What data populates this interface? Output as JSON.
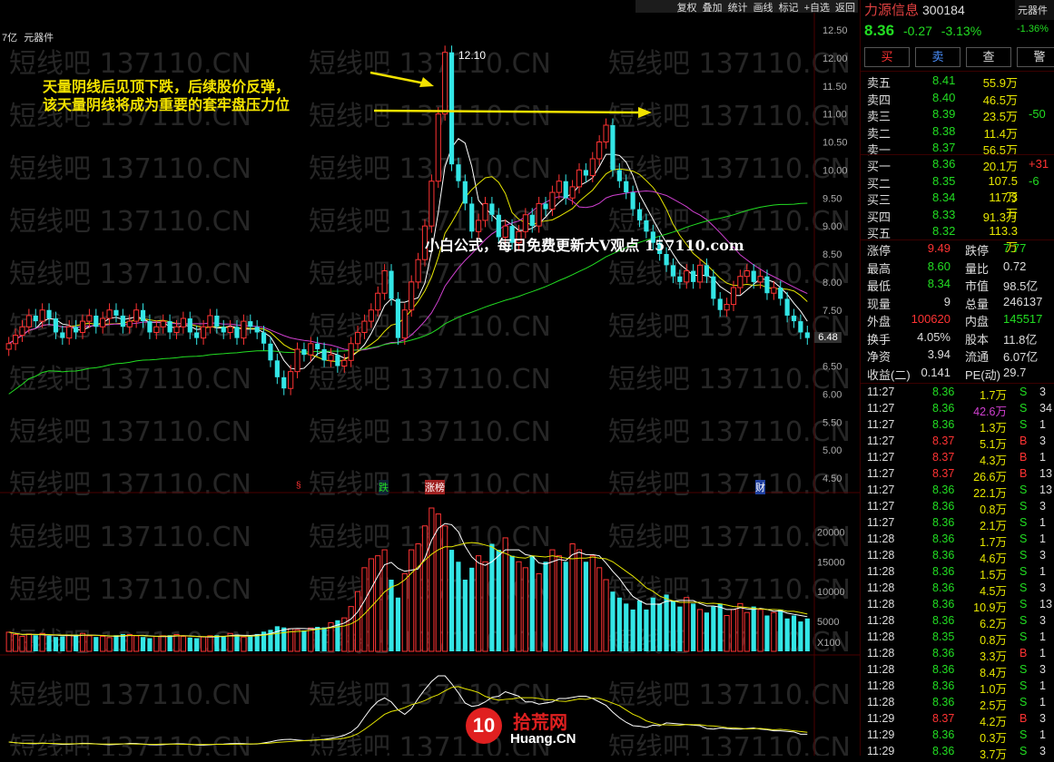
{
  "toolbar": [
    "复权",
    "叠加",
    "统计",
    "画线",
    "标记",
    "+自选",
    "返回"
  ],
  "chart_header": {
    "prefix": "7亿",
    "sector": "元器件"
  },
  "watermark_text": "短线吧 137110.CN",
  "annotation": {
    "line1": "天量阴线后见顶下跌，后续股价反弹，",
    "line2": "该天量阴线将成为重要的套牢盘压力位",
    "promo": "小白公式，每日免费更新大V观点 157110.com",
    "peak_label": "12.10",
    "last_price_tag": "6.48"
  },
  "event_tags": [
    "§",
    "跌",
    "涨榜",
    "财"
  ],
  "price_axis": [
    "12.50",
    "12.00",
    "11.50",
    "11.00",
    "10.50",
    "10.00",
    "9.50",
    "9.00",
    "8.50",
    "8.00",
    "7.50",
    "7.00",
    "6.50",
    "6.00",
    "5.50",
    "5.00",
    "4.50"
  ],
  "volume_axis": [
    "20000",
    "15000",
    "10000",
    "5000",
    "X100"
  ],
  "logo": {
    "main": "拾荒网",
    "sub": "Huang.CN",
    "badge": "10"
  },
  "stock": {
    "name": "力源信息",
    "code": "300184",
    "price": "8.36",
    "change": "-0.27",
    "pct": "-3.13%",
    "side_name": "元器件",
    "side_pct": "-1.36%"
  },
  "buttons": [
    "买",
    "卖",
    "查",
    "警"
  ],
  "sell_book": [
    {
      "label": "卖五",
      "price": "8.41",
      "vol": "55.9万"
    },
    {
      "label": "卖四",
      "price": "8.40",
      "vol": "46.5万"
    },
    {
      "label": "卖三",
      "price": "8.39",
      "vol": "23.5万",
      "extra": "-50"
    },
    {
      "label": "卖二",
      "price": "8.38",
      "vol": "11.4万"
    },
    {
      "label": "卖一",
      "price": "8.37",
      "vol": "56.5万"
    }
  ],
  "buy_book": [
    {
      "label": "买一",
      "price": "8.36",
      "vol": "20.1万",
      "extra": "+31"
    },
    {
      "label": "买二",
      "price": "8.35",
      "vol": "107.5万",
      "extra": "-6"
    },
    {
      "label": "买三",
      "price": "8.34",
      "vol": "117.3万"
    },
    {
      "label": "买四",
      "price": "8.33",
      "vol": "91.3万"
    },
    {
      "label": "买五",
      "price": "8.32",
      "vol": "113.3万"
    }
  ],
  "stats": [
    {
      "k1": "涨停",
      "v1": "9.49",
      "k2": "跌停",
      "v2": "7.77"
    },
    {
      "k1": "最高",
      "v1": "8.60",
      "k2": "量比",
      "v2": "0.72"
    },
    {
      "k1": "最低",
      "v1": "8.34",
      "k2": "市值",
      "v2": "98.5亿"
    },
    {
      "k1": "现量",
      "v1": "9",
      "k2": "总量",
      "v2": "246137"
    },
    {
      "k1": "外盘",
      "v1": "100620",
      "k2": "内盘",
      "v2": "145517"
    },
    {
      "k1": "换手",
      "v1": "4.05%",
      "k2": "股本",
      "v2": "11.8亿"
    },
    {
      "k1": "净资",
      "v1": "3.94",
      "k2": "流通",
      "v2": "6.07亿"
    },
    {
      "k1": "收益(二)",
      "v1": "0.141",
      "k2": "PE(动)",
      "v2": "29.7"
    }
  ],
  "ticks": [
    {
      "t": "11:27",
      "p": "8.36",
      "v": "1.7万",
      "s": "S",
      "x": "3"
    },
    {
      "t": "11:27",
      "p": "8.36",
      "v": "42.6万",
      "s": "S",
      "x": "34"
    },
    {
      "t": "11:27",
      "p": "8.36",
      "v": "1.3万",
      "s": "S",
      "x": "1"
    },
    {
      "t": "11:27",
      "p": "8.37",
      "v": "5.1万",
      "s": "B",
      "x": "3"
    },
    {
      "t": "11:27",
      "p": "8.37",
      "v": "4.3万",
      "s": "B",
      "x": "1"
    },
    {
      "t": "11:27",
      "p": "8.37",
      "v": "26.6万",
      "s": "B",
      "x": "13"
    },
    {
      "t": "11:27",
      "p": "8.36",
      "v": "22.1万",
      "s": "S",
      "x": "13"
    },
    {
      "t": "11:27",
      "p": "8.36",
      "v": "0.8万",
      "s": "S",
      "x": "3"
    },
    {
      "t": "11:27",
      "p": "8.36",
      "v": "2.1万",
      "s": "S",
      "x": "1"
    },
    {
      "t": "11:28",
      "p": "8.36",
      "v": "1.7万",
      "s": "S",
      "x": "1"
    },
    {
      "t": "11:28",
      "p": "8.36",
      "v": "4.6万",
      "s": "S",
      "x": "3"
    },
    {
      "t": "11:28",
      "p": "8.36",
      "v": "1.5万",
      "s": "S",
      "x": "1"
    },
    {
      "t": "11:28",
      "p": "8.36",
      "v": "4.5万",
      "s": "S",
      "x": "3"
    },
    {
      "t": "11:28",
      "p": "8.36",
      "v": "10.9万",
      "s": "S",
      "x": "13"
    },
    {
      "t": "11:28",
      "p": "8.36",
      "v": "6.2万",
      "s": "S",
      "x": "3"
    },
    {
      "t": "11:28",
      "p": "8.35",
      "v": "0.8万",
      "s": "S",
      "x": "1"
    },
    {
      "t": "11:28",
      "p": "8.36",
      "v": "3.3万",
      "s": "B",
      "x": "1"
    },
    {
      "t": "11:28",
      "p": "8.36",
      "v": "8.4万",
      "s": "S",
      "x": "3"
    },
    {
      "t": "11:28",
      "p": "8.36",
      "v": "1.0万",
      "s": "S",
      "x": "1"
    },
    {
      "t": "11:28",
      "p": "8.36",
      "v": "2.5万",
      "s": "S",
      "x": "1"
    },
    {
      "t": "11:29",
      "p": "8.37",
      "v": "4.2万",
      "s": "B",
      "x": "3"
    },
    {
      "t": "11:29",
      "p": "8.36",
      "v": "0.3万",
      "s": "S",
      "x": "1"
    },
    {
      "t": "11:29",
      "p": "8.36",
      "v": "3.7万",
      "s": "S",
      "x": "3"
    }
  ],
  "colors": {
    "up": "#ff3333",
    "down": "#33e6e6",
    "ma5": "#ffffff",
    "ma10": "#e6e600",
    "ma20": "#d040d0",
    "ma60": "#22dd22"
  },
  "chart_data": {
    "type": "candlestick",
    "closes": [
      6.9,
      7.05,
      7.2,
      7.4,
      7.3,
      7.5,
      7.35,
      7.1,
      7.0,
      7.2,
      7.1,
      7.3,
      7.4,
      7.2,
      7.35,
      7.5,
      7.4,
      7.2,
      7.3,
      7.5,
      7.3,
      7.1,
      7.2,
      7.3,
      7.1,
      7.2,
      7.35,
      7.1,
      7.0,
      7.2,
      7.4,
      7.2,
      7.1,
      7.2,
      7.0,
      7.3,
      7.2,
      7.1,
      6.9,
      6.6,
      6.3,
      6.1,
      6.4,
      6.8,
      6.7,
      6.9,
      6.8,
      6.6,
      6.7,
      6.5,
      6.6,
      6.9,
      7.1,
      7.3,
      7.5,
      7.8,
      8.2,
      7.7,
      7.0,
      7.5,
      8.0,
      8.4,
      9.0,
      9.8,
      11.0,
      12.1,
      10.1,
      9.8,
      9.4,
      8.9,
      9.1,
      9.4,
      9.2,
      8.8,
      9.0,
      8.7,
      8.9,
      9.2,
      9.0,
      9.4,
      9.3,
      9.6,
      9.8,
      9.5,
      9.7,
      10.0,
      9.9,
      10.2,
      10.5,
      10.8,
      10.0,
      9.8,
      9.6,
      9.3,
      9.1,
      8.9,
      8.7,
      8.5,
      8.3,
      8.1,
      8.0,
      8.2,
      8.0,
      8.3,
      8.1,
      7.7,
      7.5,
      7.6,
      7.9,
      8.1,
      8.2,
      8.0,
      8.1,
      7.8,
      7.9,
      7.7,
      7.4,
      7.3,
      7.1,
      7.0
    ],
    "volumes": [
      3200,
      2800,
      2500,
      2900,
      2700,
      3000,
      2600,
      2400,
      2500,
      2700,
      2800,
      3000,
      2600,
      2400,
      2500,
      2300,
      2700,
      2900,
      2800,
      2600,
      2400,
      2200,
      2500,
      2600,
      2700,
      2800,
      2500,
      2300,
      2200,
      2400,
      2600,
      2700,
      2500,
      3000,
      2800,
      2400,
      2600,
      2900,
      3300,
      3600,
      4200,
      4000,
      3800,
      3600,
      3500,
      3900,
      4100,
      4000,
      4800,
      5200,
      5600,
      7500,
      10000,
      14000,
      15500,
      16000,
      17000,
      12000,
      9000,
      13000,
      17000,
      18000,
      21000,
      24000,
      23000,
      21000,
      17000,
      15000,
      12000,
      14000,
      16000,
      15000,
      18000,
      17000,
      19000,
      16000,
      15000,
      14000,
      16000,
      13000,
      15000,
      17000,
      16000,
      15000,
      18000,
      17000,
      15000,
      16000,
      14000,
      12000,
      10000,
      9000,
      8000,
      7000,
      8500,
      7000,
      9000,
      8000,
      9500,
      8500,
      7500,
      9000,
      8000,
      7000,
      6500,
      7500,
      8000,
      6000,
      7000,
      8000,
      6500,
      7500,
      7000,
      6000,
      6500,
      7000,
      5500,
      6000,
      5000,
      5500
    ],
    "ylim": [
      4.5,
      12.5
    ],
    "volume_ylim": [
      0,
      24000
    ]
  }
}
